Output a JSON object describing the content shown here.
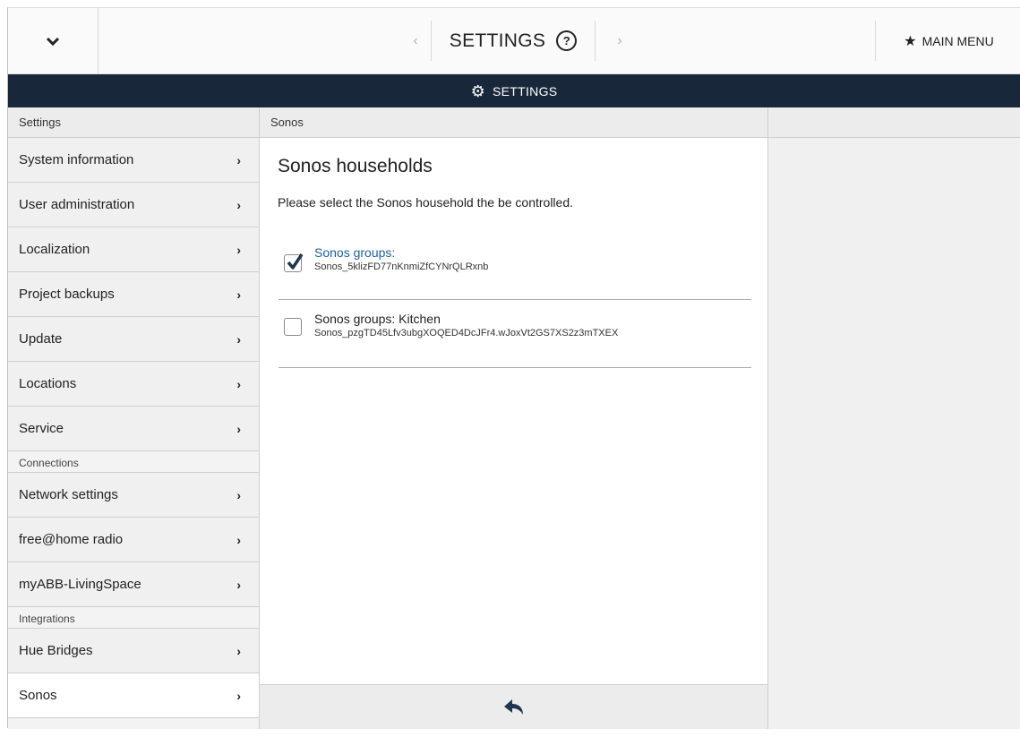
{
  "topbar": {
    "dropdown_icon": "chevron-down-icon",
    "prev_icon": "chevron-left-icon",
    "title": "SETTINGS",
    "help_icon": "help-circle-icon",
    "help_glyph": "?",
    "next_icon": "chevron-right-icon",
    "main_menu_icon": "star-icon",
    "main_menu_label": "MAIN MENU"
  },
  "header_bar": {
    "icon": "gear-icon",
    "title": "SETTINGS"
  },
  "columns": {
    "left": "Settings",
    "middle": "Sonos",
    "right": ""
  },
  "sidebar": {
    "items": [
      {
        "label": "System information"
      },
      {
        "label": "User administration"
      },
      {
        "label": "Localization"
      },
      {
        "label": "Project backups"
      },
      {
        "label": "Update"
      },
      {
        "label": "Locations"
      },
      {
        "label": "Service"
      }
    ],
    "section_connections": "Connections",
    "connections_items": [
      {
        "label": "Network settings"
      },
      {
        "label": "free@home radio"
      },
      {
        "label": "myABB-LivingSpace"
      }
    ],
    "section_integrations": "Integrations",
    "integrations_items": [
      {
        "label": "Hue Bridges"
      },
      {
        "label": "Sonos",
        "active": true
      }
    ]
  },
  "main": {
    "heading": "Sonos households",
    "description": "Please select the Sonos household the be controlled.",
    "households": [
      {
        "name": "Sonos groups:",
        "id": "Sonos_5klizFD77nKnmiZfCYNrQLRxnb",
        "checked": true
      },
      {
        "name": "Sonos groups: Kitchen",
        "id": "Sonos_pzgTD45Lfv3ubgXOQED4DcJFr4.wJoxVt2GS7XS2z3mTXEX",
        "checked": false
      }
    ]
  },
  "bottom_bar": {
    "back_icon": "back-arrow-icon"
  },
  "colors": {
    "dark_bar": "#18283a",
    "link_blue": "#1a5fa8",
    "sidebar_bg": "#f0f0f0"
  }
}
